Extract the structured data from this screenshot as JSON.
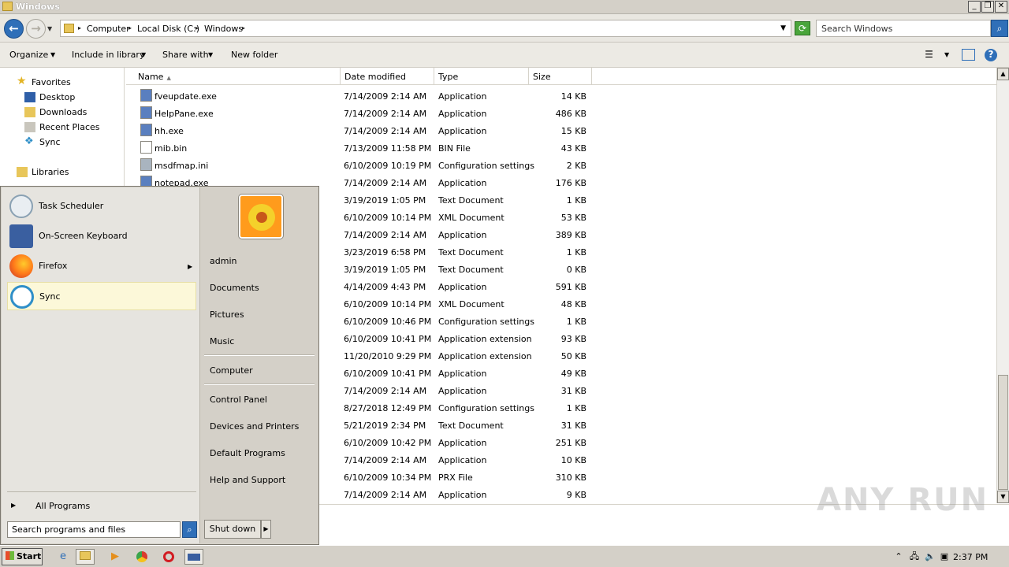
{
  "window": {
    "title": "Windows"
  },
  "address": {
    "crumbs": [
      "Computer",
      "Local Disk (C:)",
      "Windows"
    ],
    "search_placeholder": "Search Windows"
  },
  "toolbar": {
    "organize": "Organize",
    "include_in_library": "Include in library",
    "share_with": "Share with",
    "new_folder": "New folder"
  },
  "nav": {
    "favorites": "Favorites",
    "items": [
      "Desktop",
      "Downloads",
      "Recent Places",
      "Sync"
    ],
    "libraries": "Libraries"
  },
  "columns": {
    "name": "Name",
    "date": "Date modified",
    "type": "Type",
    "size": "Size"
  },
  "files": [
    {
      "name": "fveupdate.exe",
      "date": "7/14/2009 2:14 AM",
      "type": "Application",
      "size": "14 KB"
    },
    {
      "name": "HelpPane.exe",
      "date": "7/14/2009 2:14 AM",
      "type": "Application",
      "size": "486 KB"
    },
    {
      "name": "hh.exe",
      "date": "7/14/2009 2:14 AM",
      "type": "Application",
      "size": "15 KB"
    },
    {
      "name": "mib.bin",
      "date": "7/13/2009 11:58 PM",
      "type": "BIN File",
      "size": "43 KB"
    },
    {
      "name": "msdfmap.ini",
      "date": "6/10/2009 10:19 PM",
      "type": "Configuration settings",
      "size": "2 KB"
    },
    {
      "name": "notepad.exe",
      "date": "7/14/2009 2:14 AM",
      "type": "Application",
      "size": "176 KB"
    },
    {
      "name": "",
      "date": "3/19/2019 1:05 PM",
      "type": "Text Document",
      "size": "1 KB"
    },
    {
      "name": "",
      "date": "6/10/2009 10:14 PM",
      "type": "XML Document",
      "size": "53 KB"
    },
    {
      "name": "",
      "date": "7/14/2009 2:14 AM",
      "type": "Application",
      "size": "389 KB"
    },
    {
      "name": "",
      "date": "3/23/2019 6:58 PM",
      "type": "Text Document",
      "size": "1 KB"
    },
    {
      "name": "",
      "date": "3/19/2019 1:05 PM",
      "type": "Text Document",
      "size": "0 KB"
    },
    {
      "name": "",
      "date": "4/14/2009 4:43 PM",
      "type": "Application",
      "size": "591 KB"
    },
    {
      "name": "",
      "date": "6/10/2009 10:14 PM",
      "type": "XML Document",
      "size": "48 KB"
    },
    {
      "name": "",
      "date": "6/10/2009 10:46 PM",
      "type": "Configuration settings",
      "size": "1 KB"
    },
    {
      "name": "",
      "date": "6/10/2009 10:41 PM",
      "type": "Application extension",
      "size": "93 KB"
    },
    {
      "name": "",
      "date": "11/20/2010 9:29 PM",
      "type": "Application extension",
      "size": "50 KB"
    },
    {
      "name": "",
      "date": "6/10/2009 10:41 PM",
      "type": "Application",
      "size": "49 KB"
    },
    {
      "name": "",
      "date": "7/14/2009 2:14 AM",
      "type": "Application",
      "size": "31 KB"
    },
    {
      "name": "",
      "date": "8/27/2018 12:49 PM",
      "type": "Configuration settings",
      "size": "1 KB"
    },
    {
      "name": "",
      "date": "5/21/2019 2:34 PM",
      "type": "Text Document",
      "size": "31 KB"
    },
    {
      "name": "",
      "date": "6/10/2009 10:42 PM",
      "type": "Application",
      "size": "251 KB"
    },
    {
      "name": "",
      "date": "7/14/2009 2:14 AM",
      "type": "Application",
      "size": "10 KB"
    },
    {
      "name": "",
      "date": "6/10/2009 10:34 PM",
      "type": "PRX File",
      "size": "310 KB"
    },
    {
      "name": "",
      "date": "7/14/2009 2:14 AM",
      "type": "Application",
      "size": "9 KB"
    }
  ],
  "start_menu": {
    "programs": [
      "Task Scheduler",
      "On-Screen Keyboard",
      "Firefox",
      "Sync"
    ],
    "all_programs": "All Programs",
    "search_placeholder": "Search programs and files",
    "right": {
      "user": "admin",
      "documents": "Documents",
      "pictures": "Pictures",
      "music": "Music",
      "computer": "Computer",
      "control_panel": "Control Panel",
      "devices": "Devices and Printers",
      "default_programs": "Default Programs",
      "help": "Help and Support"
    },
    "shutdown": "Shut down"
  },
  "taskbar": {
    "start": "Start",
    "clock": "2:37 PM"
  },
  "watermark": "ANY RUN",
  "colors": {
    "accent": "#2f6fb8",
    "highlight": "#fcf8d9"
  }
}
